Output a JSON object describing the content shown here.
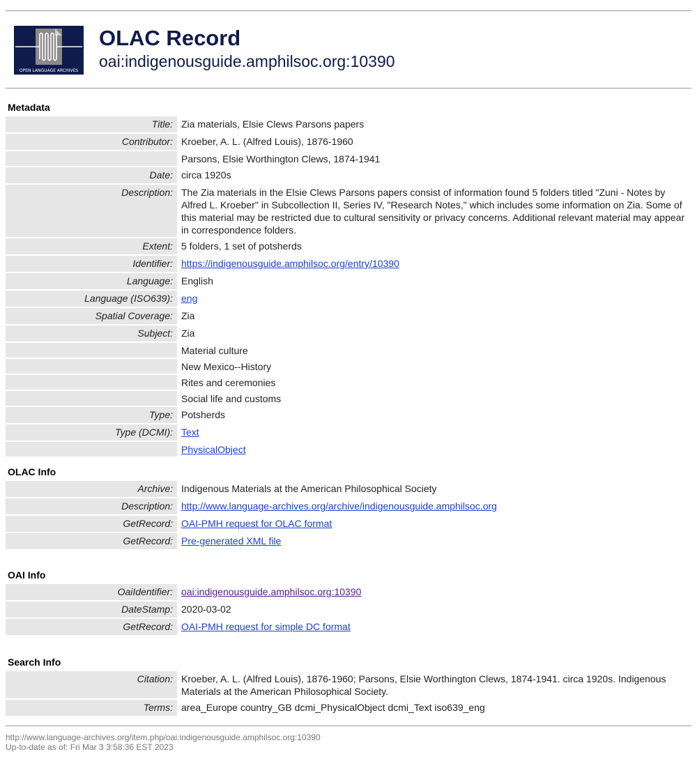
{
  "header": {
    "title": "OLAC Record",
    "subtitle": "oai:indigenousguide.amphilsoc.org:10390",
    "logo_text": "OPEN LANGUAGE ARCHIVES"
  },
  "metadata": {
    "heading": "Metadata",
    "rows": [
      {
        "label": "Title:",
        "values": [
          {
            "text": "Zia materials, Elsie Clews Parsons papers"
          }
        ]
      },
      {
        "label": "Contributor:",
        "values": [
          {
            "text": "Kroeber, A. L. (Alfred Louis), 1876-1960"
          },
          {
            "text": "Parsons, Elsie Worthington Clews, 1874-1941"
          }
        ]
      },
      {
        "label": "Date:",
        "values": [
          {
            "text": "circa 1920s"
          }
        ]
      },
      {
        "label": "Description:",
        "values": [
          {
            "text": "The Zia materials in the Elsie Clews Parsons papers consist of information found 5 folders titled \"Zuni - Notes by Alfred L. Kroeber\" in Subcollection II, Series IV, \"Research Notes,\" which includes some information on Zia. Some of this material may be restricted due to cultural sensitivity or privacy concerns. Additional relevant material may appear in correspondence folders."
          }
        ]
      },
      {
        "label": "Extent:",
        "values": [
          {
            "text": "5 folders, 1 set of potsherds"
          }
        ]
      },
      {
        "label": "Identifier:",
        "values": [
          {
            "text": "https://indigenousguide.amphilsoc.org/entry/10390",
            "link": true
          }
        ]
      },
      {
        "label": "Language:",
        "values": [
          {
            "text": "English"
          }
        ]
      },
      {
        "label": "Language (ISO639):",
        "values": [
          {
            "text": "eng",
            "link": true
          }
        ]
      },
      {
        "label": "Spatial Coverage:",
        "values": [
          {
            "text": "Zia"
          }
        ]
      },
      {
        "label": "Subject:",
        "values": [
          {
            "text": "Zia"
          },
          {
            "text": "Material culture"
          },
          {
            "text": "New Mexico--History"
          },
          {
            "text": "Rites and ceremonies"
          },
          {
            "text": "Social life and customs"
          }
        ]
      },
      {
        "label": "Type:",
        "values": [
          {
            "text": "Potsherds"
          }
        ]
      },
      {
        "label": "Type (DCMI):",
        "values": [
          {
            "text": "Text",
            "link": true
          },
          {
            "text": "PhysicalObject",
            "link": true
          }
        ]
      }
    ]
  },
  "olac_info": {
    "heading": "OLAC Info",
    "rows": [
      {
        "label": "Archive:",
        "values": [
          {
            "text": "Indigenous Materials at the American Philosophical Society"
          }
        ]
      },
      {
        "label": "Description:",
        "values": [
          {
            "text": "http://www.language-archives.org/archive/indigenousguide.amphilsoc.org",
            "link": true
          }
        ]
      },
      {
        "label": "GetRecord:",
        "values": [
          {
            "text": "OAI-PMH request for OLAC format",
            "link": true
          }
        ]
      },
      {
        "label": "GetRecord:",
        "values": [
          {
            "text": "Pre-generated XML file",
            "link": true
          }
        ]
      }
    ]
  },
  "oai_info": {
    "heading": "OAI Info",
    "rows": [
      {
        "label": "OaiIdentifier:",
        "values": [
          {
            "text": "oai:indigenousguide.amphilsoc.org:10390",
            "link": true,
            "visited": true
          }
        ]
      },
      {
        "label": "DateStamp:",
        "values": [
          {
            "text": "2020-03-02"
          }
        ]
      },
      {
        "label": "GetRecord:",
        "values": [
          {
            "text": "OAI-PMH request for simple DC format",
            "link": true
          }
        ]
      }
    ]
  },
  "search_info": {
    "heading": "Search Info",
    "rows": [
      {
        "label": "Citation:",
        "values": [
          {
            "text": "Kroeber, A. L. (Alfred Louis), 1876-1960; Parsons, Elsie Worthington Clews, 1874-1941. circa 1920s. Indigenous Materials at the American Philosophical Society."
          }
        ]
      },
      {
        "label": "Terms:",
        "values": [
          {
            "text": "area_Europe country_GB dcmi_PhysicalObject dcmi_Text iso639_eng"
          }
        ]
      }
    ]
  },
  "footer": {
    "url": "http://www.language-archives.org/item.php/oai:indigenousguide.amphilsoc.org:10390",
    "updated": "Up-to-date as of: Fri Mar 3 3:58:36 EST 2023"
  },
  "colors": {
    "title": "#0f1b4c",
    "link": "#1a3fd1",
    "visited_link": "#551a8b",
    "label_bg": "#e6e6e6",
    "logo_bg": "#0f1b4c"
  }
}
